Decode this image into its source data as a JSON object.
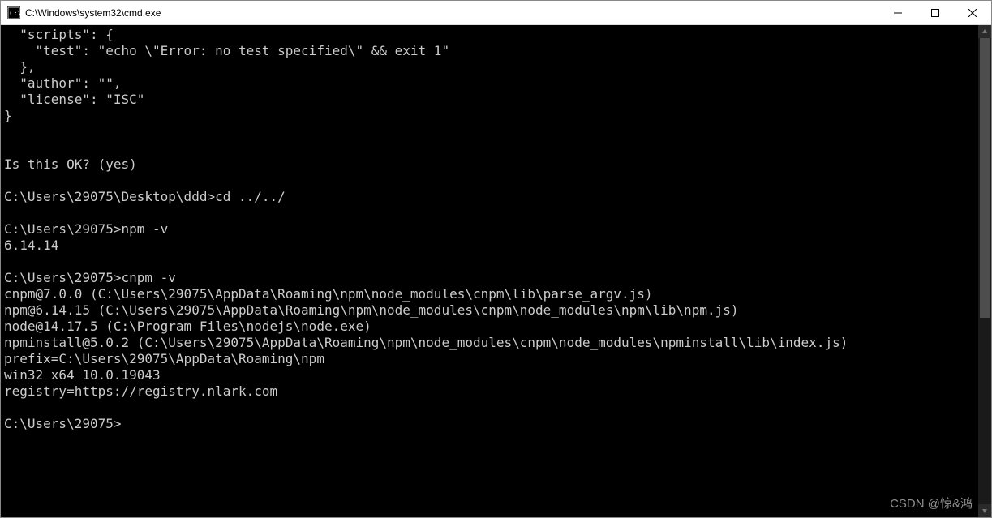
{
  "titlebar": {
    "title": "C:\\Windows\\system32\\cmd.exe"
  },
  "terminal": {
    "lines": [
      "  \"scripts\": {",
      "    \"test\": \"echo \\\"Error: no test specified\\\" && exit 1\"",
      "  },",
      "  \"author\": \"\",",
      "  \"license\": \"ISC\"",
      "}",
      "",
      "",
      "Is this OK? (yes)",
      "",
      "C:\\Users\\29075\\Desktop\\ddd>cd ../../",
      "",
      "C:\\Users\\29075>npm -v",
      "6.14.14",
      "",
      "C:\\Users\\29075>cnpm -v",
      "cnpm@7.0.0 (C:\\Users\\29075\\AppData\\Roaming\\npm\\node_modules\\cnpm\\lib\\parse_argv.js)",
      "npm@6.14.15 (C:\\Users\\29075\\AppData\\Roaming\\npm\\node_modules\\cnpm\\node_modules\\npm\\lib\\npm.js)",
      "node@14.17.5 (C:\\Program Files\\nodejs\\node.exe)",
      "npminstall@5.0.2 (C:\\Users\\29075\\AppData\\Roaming\\npm\\node_modules\\cnpm\\node_modules\\npminstall\\lib\\index.js)",
      "prefix=C:\\Users\\29075\\AppData\\Roaming\\npm",
      "win32 x64 10.0.19043",
      "registry=https://registry.nlark.com",
      "",
      "C:\\Users\\29075>"
    ]
  },
  "watermark": "CSDN @惊&鸿"
}
